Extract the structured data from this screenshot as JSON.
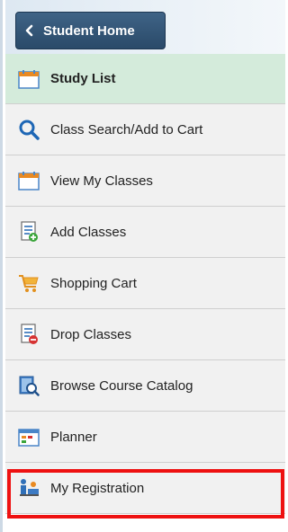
{
  "header": {
    "back_label": "Student Home"
  },
  "menu": {
    "items": [
      {
        "label": "Study List",
        "icon": "calendar-icon",
        "active": true
      },
      {
        "label": "Class Search/Add to Cart",
        "icon": "search-icon"
      },
      {
        "label": "View My Classes",
        "icon": "calendar-icon"
      },
      {
        "label": "Add Classes",
        "icon": "add-document-icon"
      },
      {
        "label": "Shopping Cart",
        "icon": "shopping-cart-icon"
      },
      {
        "label": "Drop Classes",
        "icon": "drop-document-icon"
      },
      {
        "label": "Browse Course Catalog",
        "icon": "catalog-icon"
      },
      {
        "label": "Planner",
        "icon": "planner-icon"
      },
      {
        "label": "My Registration",
        "icon": "registration-icon",
        "highlighted": true
      }
    ]
  },
  "colors": {
    "header_button": "#2f5273",
    "active_row": "#d4ebdb",
    "row_bg": "#f1f1f1",
    "highlight_border": "#ee1111"
  }
}
